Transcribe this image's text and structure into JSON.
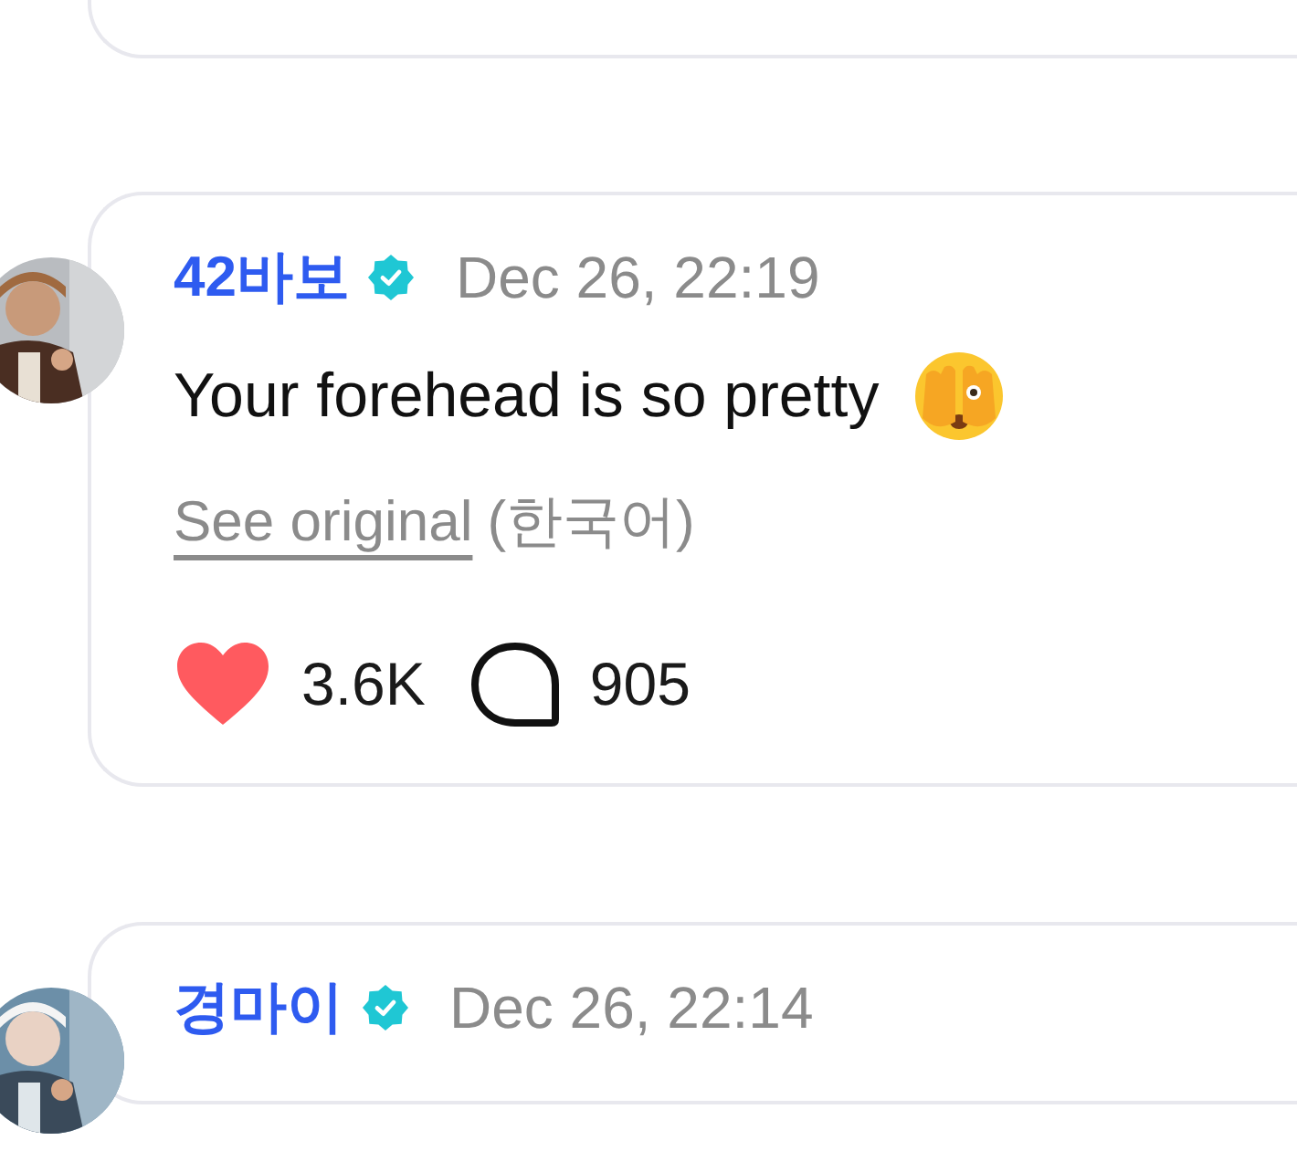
{
  "comments": [
    {
      "author": "42바보",
      "verified": true,
      "date": "Dec 26, 22:19",
      "text": "Your forehead is so pretty",
      "emoji": true,
      "see_original": "See original",
      "language": "(한국어)",
      "liked": true,
      "likes": "3.6K",
      "replies": "905"
    },
    {
      "author": "경마이",
      "verified": true,
      "date": "Dec 26, 22:14"
    }
  ]
}
